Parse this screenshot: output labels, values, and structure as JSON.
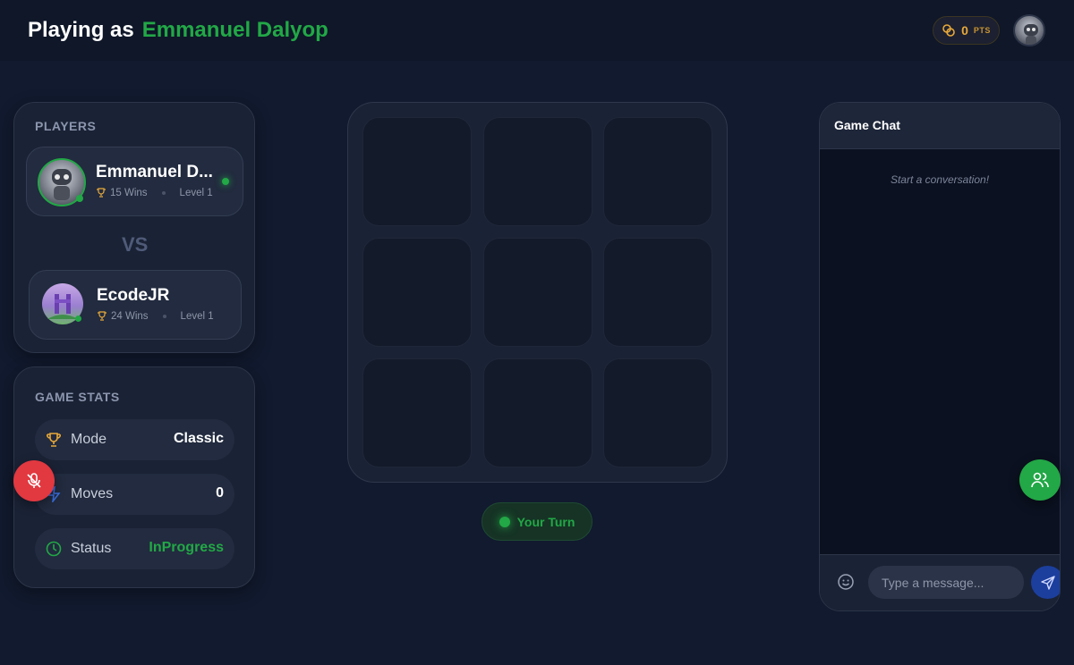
{
  "header": {
    "prefix": "Playing as",
    "player_name": "Emmanuel Dalyop",
    "points_value": "0",
    "points_unit": "PTS"
  },
  "players": {
    "label": "PLAYERS",
    "vs": "VS",
    "list": [
      {
        "name": "Emmanuel D...",
        "wins": "15 Wins",
        "level": "Level 1"
      },
      {
        "name": "EcodeJR",
        "wins": "24 Wins",
        "level": "Level 1"
      }
    ]
  },
  "stats": {
    "label": "GAME STATS",
    "rows": [
      {
        "label": "Mode",
        "value": "Classic",
        "icon": "trophy-icon"
      },
      {
        "label": "Moves",
        "value": "0",
        "icon": "bolt-icon"
      },
      {
        "label": "Status",
        "value": "InProgress",
        "icon": "clock-icon"
      }
    ]
  },
  "board": {
    "cells": [
      "",
      "",
      "",
      "",
      "",
      "",
      "",
      "",
      ""
    ]
  },
  "turn": {
    "label": "Your Turn"
  },
  "chat": {
    "title": "Game Chat",
    "empty": "Start a conversation!",
    "placeholder": "Type a message..."
  },
  "colors": {
    "accent_green": "#22a846",
    "points_gold": "#e8a93a",
    "danger_red": "#e23840",
    "send_blue": "#1c3f9e"
  }
}
